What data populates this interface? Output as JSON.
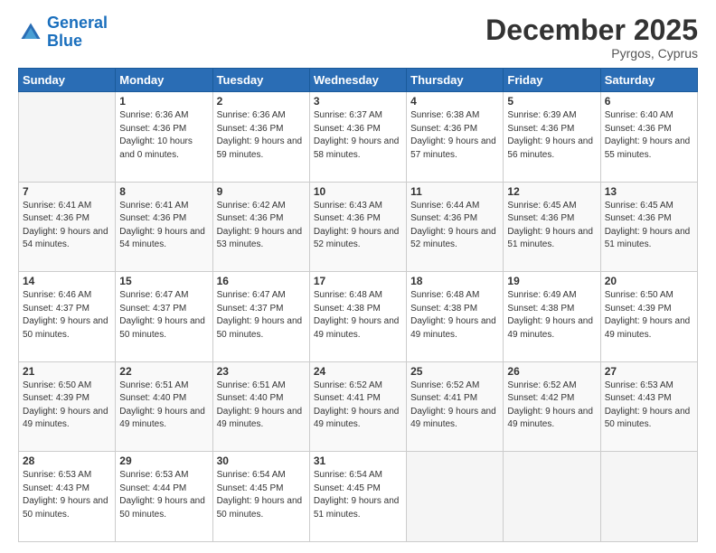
{
  "logo": {
    "line1": "General",
    "line2": "Blue"
  },
  "header": {
    "month": "December 2025",
    "location": "Pyrgos, Cyprus"
  },
  "weekdays": [
    "Sunday",
    "Monday",
    "Tuesday",
    "Wednesday",
    "Thursday",
    "Friday",
    "Saturday"
  ],
  "weeks": [
    [
      {
        "day": "",
        "sunrise": "",
        "sunset": "",
        "daylight": ""
      },
      {
        "day": "1",
        "sunrise": "Sunrise: 6:36 AM",
        "sunset": "Sunset: 4:36 PM",
        "daylight": "Daylight: 10 hours and 0 minutes."
      },
      {
        "day": "2",
        "sunrise": "Sunrise: 6:36 AM",
        "sunset": "Sunset: 4:36 PM",
        "daylight": "Daylight: 9 hours and 59 minutes."
      },
      {
        "day": "3",
        "sunrise": "Sunrise: 6:37 AM",
        "sunset": "Sunset: 4:36 PM",
        "daylight": "Daylight: 9 hours and 58 minutes."
      },
      {
        "day": "4",
        "sunrise": "Sunrise: 6:38 AM",
        "sunset": "Sunset: 4:36 PM",
        "daylight": "Daylight: 9 hours and 57 minutes."
      },
      {
        "day": "5",
        "sunrise": "Sunrise: 6:39 AM",
        "sunset": "Sunset: 4:36 PM",
        "daylight": "Daylight: 9 hours and 56 minutes."
      },
      {
        "day": "6",
        "sunrise": "Sunrise: 6:40 AM",
        "sunset": "Sunset: 4:36 PM",
        "daylight": "Daylight: 9 hours and 55 minutes."
      }
    ],
    [
      {
        "day": "7",
        "sunrise": "Sunrise: 6:41 AM",
        "sunset": "Sunset: 4:36 PM",
        "daylight": "Daylight: 9 hours and 54 minutes."
      },
      {
        "day": "8",
        "sunrise": "Sunrise: 6:41 AM",
        "sunset": "Sunset: 4:36 PM",
        "daylight": "Daylight: 9 hours and 54 minutes."
      },
      {
        "day": "9",
        "sunrise": "Sunrise: 6:42 AM",
        "sunset": "Sunset: 4:36 PM",
        "daylight": "Daylight: 9 hours and 53 minutes."
      },
      {
        "day": "10",
        "sunrise": "Sunrise: 6:43 AM",
        "sunset": "Sunset: 4:36 PM",
        "daylight": "Daylight: 9 hours and 52 minutes."
      },
      {
        "day": "11",
        "sunrise": "Sunrise: 6:44 AM",
        "sunset": "Sunset: 4:36 PM",
        "daylight": "Daylight: 9 hours and 52 minutes."
      },
      {
        "day": "12",
        "sunrise": "Sunrise: 6:45 AM",
        "sunset": "Sunset: 4:36 PM",
        "daylight": "Daylight: 9 hours and 51 minutes."
      },
      {
        "day": "13",
        "sunrise": "Sunrise: 6:45 AM",
        "sunset": "Sunset: 4:36 PM",
        "daylight": "Daylight: 9 hours and 51 minutes."
      }
    ],
    [
      {
        "day": "14",
        "sunrise": "Sunrise: 6:46 AM",
        "sunset": "Sunset: 4:37 PM",
        "daylight": "Daylight: 9 hours and 50 minutes."
      },
      {
        "day": "15",
        "sunrise": "Sunrise: 6:47 AM",
        "sunset": "Sunset: 4:37 PM",
        "daylight": "Daylight: 9 hours and 50 minutes."
      },
      {
        "day": "16",
        "sunrise": "Sunrise: 6:47 AM",
        "sunset": "Sunset: 4:37 PM",
        "daylight": "Daylight: 9 hours and 50 minutes."
      },
      {
        "day": "17",
        "sunrise": "Sunrise: 6:48 AM",
        "sunset": "Sunset: 4:38 PM",
        "daylight": "Daylight: 9 hours and 49 minutes."
      },
      {
        "day": "18",
        "sunrise": "Sunrise: 6:48 AM",
        "sunset": "Sunset: 4:38 PM",
        "daylight": "Daylight: 9 hours and 49 minutes."
      },
      {
        "day": "19",
        "sunrise": "Sunrise: 6:49 AM",
        "sunset": "Sunset: 4:38 PM",
        "daylight": "Daylight: 9 hours and 49 minutes."
      },
      {
        "day": "20",
        "sunrise": "Sunrise: 6:50 AM",
        "sunset": "Sunset: 4:39 PM",
        "daylight": "Daylight: 9 hours and 49 minutes."
      }
    ],
    [
      {
        "day": "21",
        "sunrise": "Sunrise: 6:50 AM",
        "sunset": "Sunset: 4:39 PM",
        "daylight": "Daylight: 9 hours and 49 minutes."
      },
      {
        "day": "22",
        "sunrise": "Sunrise: 6:51 AM",
        "sunset": "Sunset: 4:40 PM",
        "daylight": "Daylight: 9 hours and 49 minutes."
      },
      {
        "day": "23",
        "sunrise": "Sunrise: 6:51 AM",
        "sunset": "Sunset: 4:40 PM",
        "daylight": "Daylight: 9 hours and 49 minutes."
      },
      {
        "day": "24",
        "sunrise": "Sunrise: 6:52 AM",
        "sunset": "Sunset: 4:41 PM",
        "daylight": "Daylight: 9 hours and 49 minutes."
      },
      {
        "day": "25",
        "sunrise": "Sunrise: 6:52 AM",
        "sunset": "Sunset: 4:41 PM",
        "daylight": "Daylight: 9 hours and 49 minutes."
      },
      {
        "day": "26",
        "sunrise": "Sunrise: 6:52 AM",
        "sunset": "Sunset: 4:42 PM",
        "daylight": "Daylight: 9 hours and 49 minutes."
      },
      {
        "day": "27",
        "sunrise": "Sunrise: 6:53 AM",
        "sunset": "Sunset: 4:43 PM",
        "daylight": "Daylight: 9 hours and 50 minutes."
      }
    ],
    [
      {
        "day": "28",
        "sunrise": "Sunrise: 6:53 AM",
        "sunset": "Sunset: 4:43 PM",
        "daylight": "Daylight: 9 hours and 50 minutes."
      },
      {
        "day": "29",
        "sunrise": "Sunrise: 6:53 AM",
        "sunset": "Sunset: 4:44 PM",
        "daylight": "Daylight: 9 hours and 50 minutes."
      },
      {
        "day": "30",
        "sunrise": "Sunrise: 6:54 AM",
        "sunset": "Sunset: 4:45 PM",
        "daylight": "Daylight: 9 hours and 50 minutes."
      },
      {
        "day": "31",
        "sunrise": "Sunrise: 6:54 AM",
        "sunset": "Sunset: 4:45 PM",
        "daylight": "Daylight: 9 hours and 51 minutes."
      },
      {
        "day": "",
        "sunrise": "",
        "sunset": "",
        "daylight": ""
      },
      {
        "day": "",
        "sunrise": "",
        "sunset": "",
        "daylight": ""
      },
      {
        "day": "",
        "sunrise": "",
        "sunset": "",
        "daylight": ""
      }
    ]
  ]
}
